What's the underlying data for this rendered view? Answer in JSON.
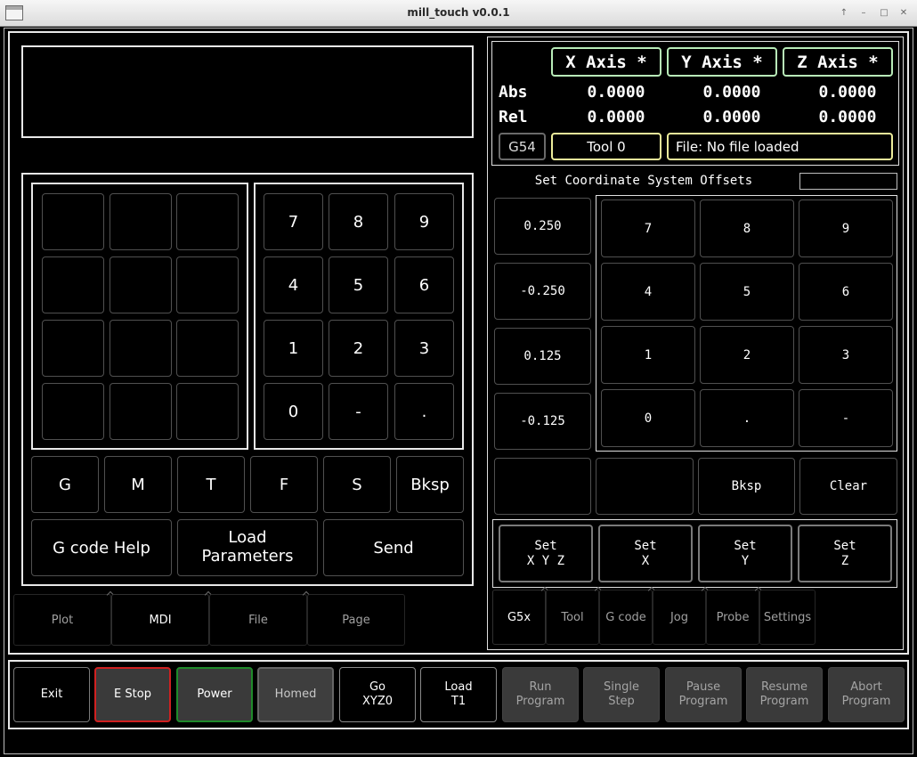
{
  "window": {
    "title": "mill_touch v0.0.1",
    "controls": [
      "↑",
      "–",
      "□",
      "✕"
    ]
  },
  "mdi": {
    "display_text": "",
    "letter_keys": [
      "",
      "",
      "",
      "",
      "",
      "",
      "",
      "",
      "",
      "",
      "",
      ""
    ],
    "number_keys": [
      "7",
      "8",
      "9",
      "4",
      "5",
      "6",
      "1",
      "2",
      "3",
      "0",
      "-",
      "."
    ],
    "word_keys": [
      "G",
      "M",
      "T",
      "F",
      "S",
      "Bksp"
    ],
    "help_label": "G code Help",
    "load_params_line1": "Load",
    "load_params_line2": "Parameters",
    "send_label": "Send"
  },
  "left_tabs": [
    "Plot",
    "MDI",
    "File",
    "Page"
  ],
  "dro": {
    "axes": [
      "X Axis *",
      "Y Axis *",
      "Z Axis *"
    ],
    "abs_label": "Abs",
    "rel_label": "Rel",
    "abs": [
      "0.0000",
      "0.0000",
      "0.0000"
    ],
    "rel": [
      "0.0000",
      "0.0000",
      "0.0000"
    ],
    "coord_system": "G54",
    "tool": "Tool 0",
    "file": "File: No file loaded"
  },
  "offsets": {
    "title": "Set Coordinate System Offsets",
    "entry_value": "",
    "presets": [
      "0.250",
      "-0.250",
      "0.125",
      "-0.125"
    ],
    "keys": [
      "7",
      "8",
      "9",
      "4",
      "5",
      "6",
      "1",
      "2",
      "3",
      "0",
      ".",
      "-"
    ],
    "bottom_keys": [
      "",
      "",
      "Bksp",
      "Clear"
    ],
    "set_buttons": [
      {
        "line1": "Set",
        "line2": "X Y Z"
      },
      {
        "line1": "Set",
        "line2": "X"
      },
      {
        "line1": "Set",
        "line2": "Y"
      },
      {
        "line1": "Set",
        "line2": "Z"
      }
    ]
  },
  "right_tabs": [
    "G5x",
    "Tool",
    "G code",
    "Jog",
    "Probe",
    "Settings"
  ],
  "bottom_bar": [
    {
      "line1": "Exit",
      "line2": ""
    },
    {
      "line1": "E Stop",
      "line2": ""
    },
    {
      "line1": "Power",
      "line2": ""
    },
    {
      "line1": "Homed",
      "line2": ""
    },
    {
      "line1": "Go",
      "line2": "XYZ0"
    },
    {
      "line1": "Load",
      "line2": "T1"
    },
    {
      "line1": "Run",
      "line2": "Program"
    },
    {
      "line1": "Single",
      "line2": "Step"
    },
    {
      "line1": "Pause",
      "line2": "Program"
    },
    {
      "line1": "Resume",
      "line2": "Program"
    },
    {
      "line1": "Abort",
      "line2": "Program"
    }
  ],
  "status_text": "",
  "colors": {
    "estop_border": "#d02020",
    "power_border": "#1f8a2a",
    "axis_border": "#b8ecb8",
    "info_border": "#ecec9a"
  }
}
